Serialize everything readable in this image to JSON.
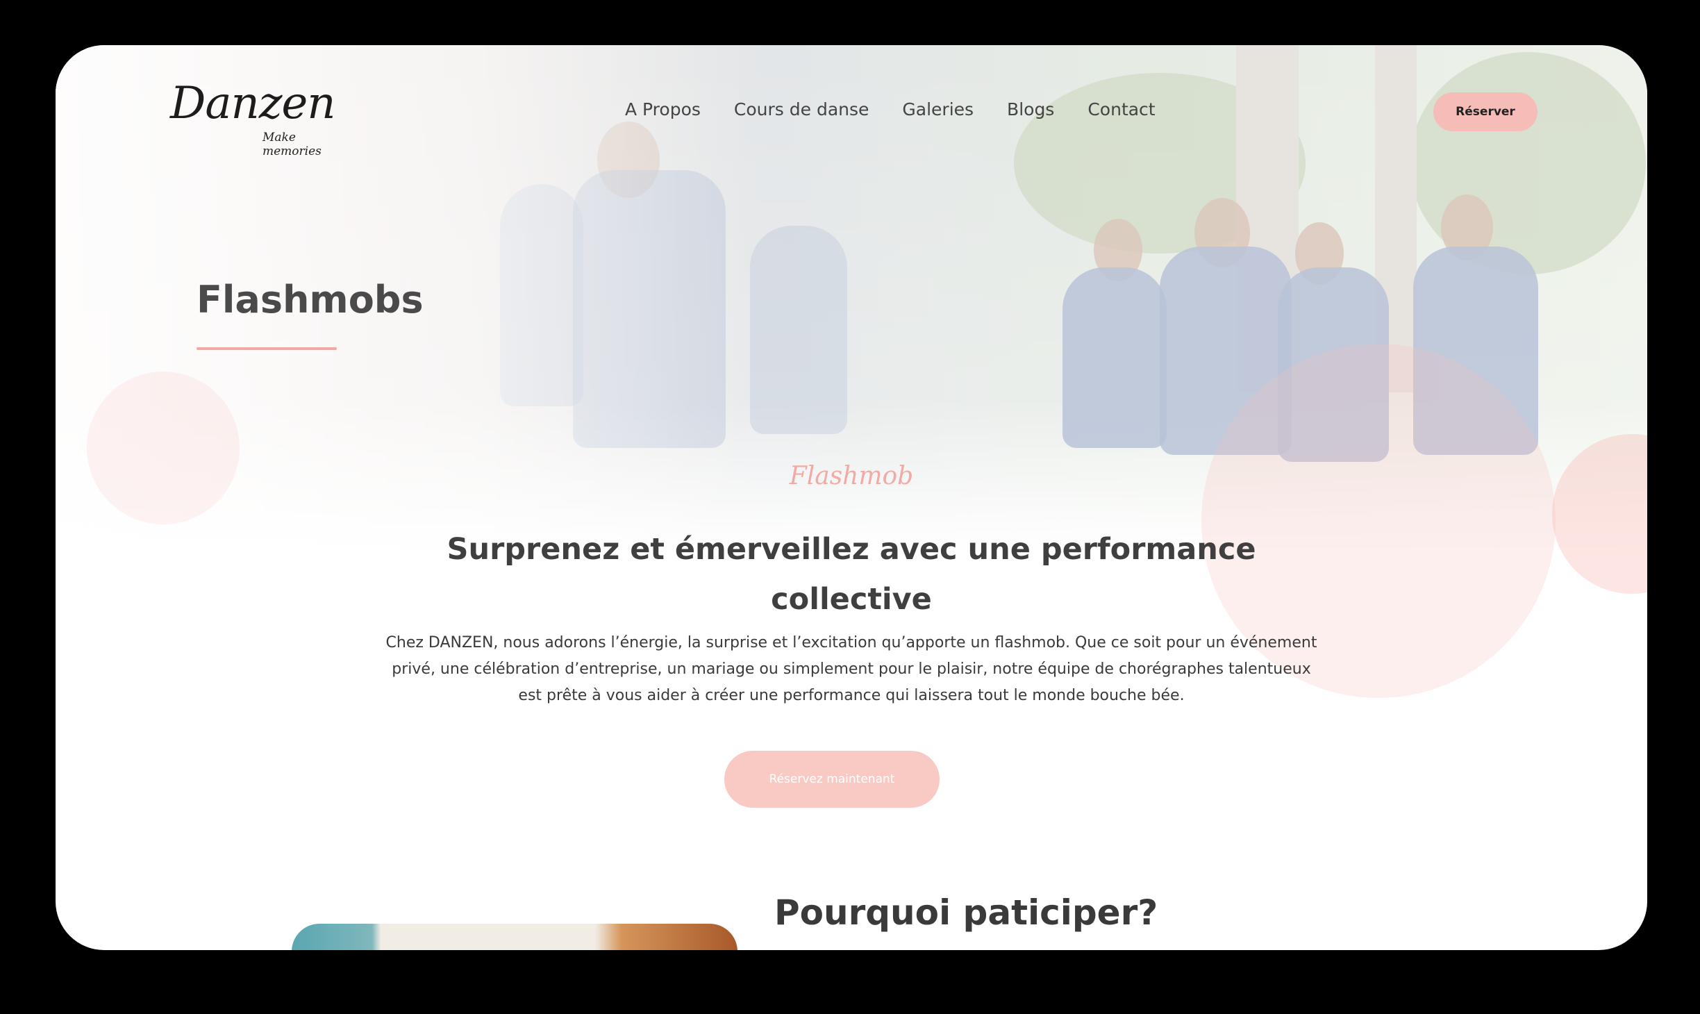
{
  "nav": {
    "logo_text": "Danzen",
    "logo_tagline": "Make memories",
    "links": [
      "A Propos",
      "Cours de danse",
      "Galeries",
      "Blogs",
      "Contact"
    ],
    "reserve_label": "Réserver"
  },
  "hero": {
    "title": "Flashmobs"
  },
  "intro": {
    "script_label": "Flashmob",
    "headline": "Surprenez et émerveillez avec une performance collective",
    "body": "Chez DANZEN, nous adorons l’énergie, la surprise et l’excitation qu’apporte un flashmob. Que ce soit pour un événement privé, une célébration d’entreprise, un mariage ou simplement pour le plaisir, notre équipe de chorégraphes talentueux est prête à vous aider à créer une performance qui laissera tout le monde bouche bée.",
    "cta_label": "Réservez maintenant"
  },
  "why": {
    "title": "Pourquoi paticiper?"
  },
  "colors": {
    "accent": "#f6bcb7",
    "text_dark": "#3f3f3f",
    "underline": "#f1a9a2"
  }
}
